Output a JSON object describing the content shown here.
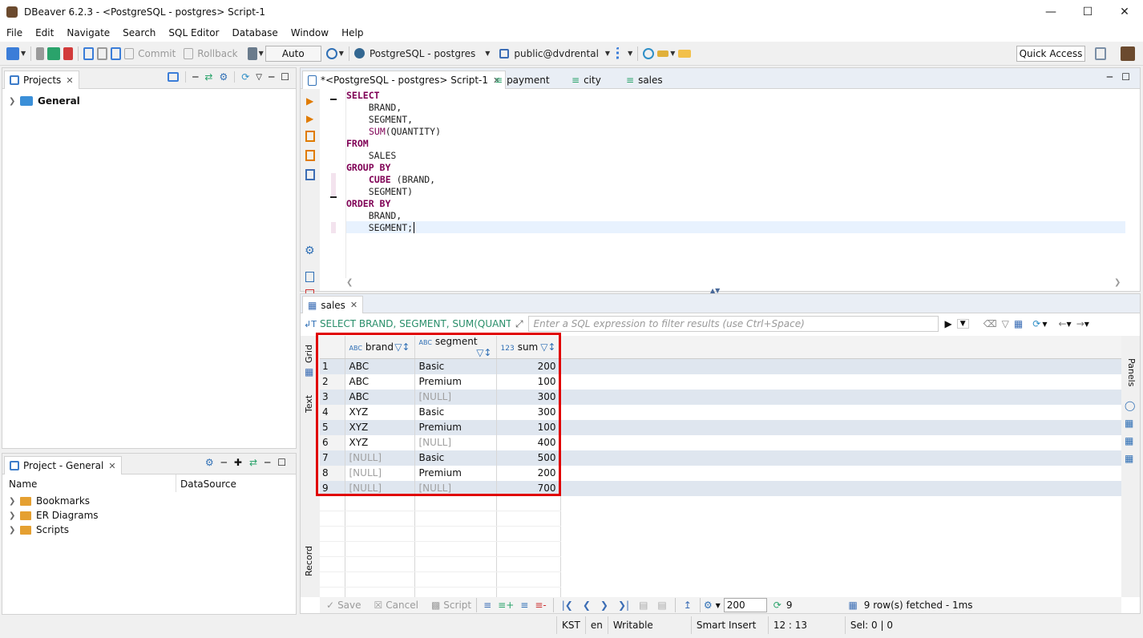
{
  "window": {
    "title": "DBeaver 6.2.3 - <PostgreSQL - postgres> Script-1"
  },
  "menu": [
    "File",
    "Edit",
    "Navigate",
    "Search",
    "SQL Editor",
    "Database",
    "Window",
    "Help"
  ],
  "toolbar": {
    "commit": "Commit",
    "rollback": "Rollback",
    "auto": "Auto",
    "datasource": "PostgreSQL - postgres",
    "schema": "public@dvdrental",
    "quick_access": "Quick Access"
  },
  "projects_panel": {
    "tab": "Projects",
    "root": "General"
  },
  "project_general": {
    "tab": "Project - General",
    "col_name": "Name",
    "col_datasource": "DataSource",
    "items": [
      "Bookmarks",
      "ER Diagrams",
      "Scripts"
    ]
  },
  "editor_tabs": [
    "*<PostgreSQL - postgres> Script-1",
    "payment",
    "city",
    "sales"
  ],
  "sql": {
    "l1": "SELECT",
    "l2": "    BRAND,",
    "l3": "    SEGMENT,",
    "l4_fn": "SUM",
    "l4_rest": "(QUANTITY)",
    "l5": "FROM",
    "l6": "    SALES",
    "l7": "GROUP BY",
    "l8_fn": "CUBE",
    "l8_rest": " (BRAND,",
    "l9": "    SEGMENT)",
    "l10": "ORDER BY",
    "l11": "    BRAND,",
    "l12": "    SEGMENT;"
  },
  "results": {
    "tab": "sales",
    "query_preview": "SELECT BRAND, SEGMENT, SUM(QUANTITY",
    "filter_placeholder": "Enter a SQL expression to filter results (use Ctrl+Space)",
    "side_grid": "Grid",
    "side_text": "Text",
    "side_record": "Record",
    "side_panels": "Panels",
    "columns": [
      {
        "type": "ABC",
        "name": "brand"
      },
      {
        "type": "ABC",
        "name": "segment"
      },
      {
        "type": "123",
        "name": "sum"
      }
    ],
    "rows": [
      [
        "1",
        "ABC",
        "Basic",
        "200"
      ],
      [
        "2",
        "ABC",
        "Premium",
        "100"
      ],
      [
        "3",
        "ABC",
        "[NULL]",
        "300"
      ],
      [
        "4",
        "XYZ",
        "Basic",
        "300"
      ],
      [
        "5",
        "XYZ",
        "Premium",
        "100"
      ],
      [
        "6",
        "XYZ",
        "[NULL]",
        "400"
      ],
      [
        "7",
        "[NULL]",
        "Basic",
        "500"
      ],
      [
        "8",
        "[NULL]",
        "Premium",
        "200"
      ],
      [
        "9",
        "[NULL]",
        "[NULL]",
        "700"
      ]
    ],
    "footer": {
      "save": "Save",
      "cancel": "Cancel",
      "script": "Script",
      "fetch_size": "200",
      "row_count": "9",
      "fetched": "9 row(s) fetched - 1ms"
    }
  },
  "statusbar": {
    "tz": "KST",
    "lang": "en",
    "mode": "Writable",
    "insert": "Smart Insert",
    "pos": "12 : 13",
    "sel": "Sel: 0 | 0"
  },
  "colors": {
    "highlight": "#e00000",
    "keyword": "#7f0055",
    "selected_tab": "#ffffff"
  }
}
